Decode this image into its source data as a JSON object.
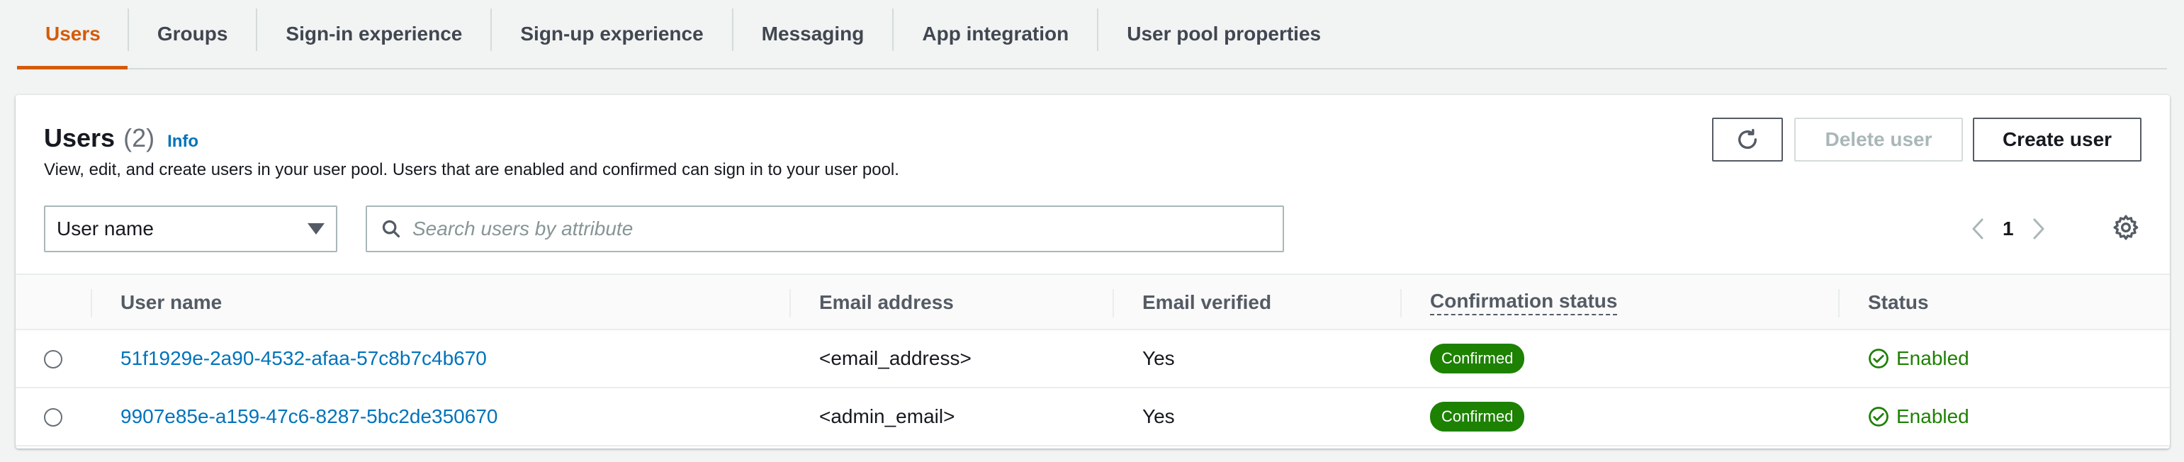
{
  "tabs": [
    {
      "label": "Users",
      "active": true
    },
    {
      "label": "Groups",
      "active": false
    },
    {
      "label": "Sign-in experience",
      "active": false
    },
    {
      "label": "Sign-up experience",
      "active": false
    },
    {
      "label": "Messaging",
      "active": false
    },
    {
      "label": "App integration",
      "active": false
    },
    {
      "label": "User pool properties",
      "active": false
    }
  ],
  "header": {
    "title": "Users",
    "count": "(2)",
    "info": "Info",
    "description": "View, edit, and create users in your user pool. Users that are enabled and confirmed can sign in to your user pool."
  },
  "actions": {
    "refresh_icon": "refresh-icon",
    "delete_label": "Delete user",
    "create_label": "Create user"
  },
  "filter": {
    "select_value": "User name",
    "search_placeholder": "Search users by attribute"
  },
  "pagination": {
    "current_page": "1"
  },
  "table": {
    "columns": [
      "User name",
      "Email address",
      "Email verified",
      "Confirmation status",
      "Status"
    ],
    "rows": [
      {
        "username": "51f1929e-2a90-4532-afaa-57c8b7c4b670",
        "email": "<email_address>",
        "email_verified": "Yes",
        "confirmation_status": "Confirmed",
        "status": "Enabled"
      },
      {
        "username": "9907e85e-a159-47c6-8287-5bc2de350670",
        "email": "<admin_email>",
        "email_verified": "Yes",
        "confirmation_status": "Confirmed",
        "status": "Enabled"
      }
    ]
  },
  "colors": {
    "accent": "#d45b07",
    "link": "#0073bb",
    "success": "#1d8102"
  }
}
